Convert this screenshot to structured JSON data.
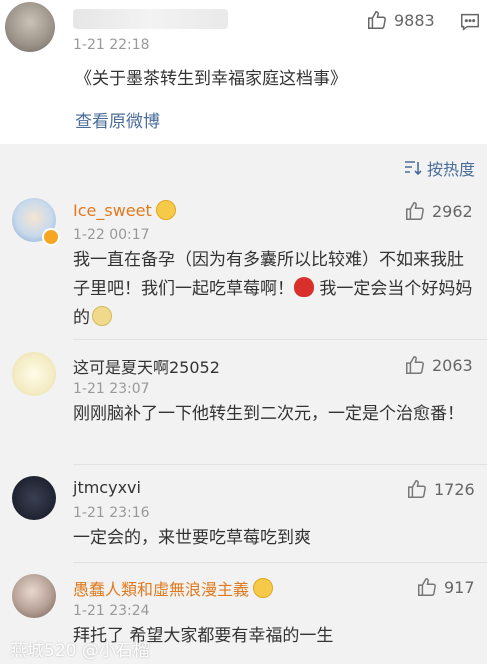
{
  "post": {
    "time": "1-21 22:18",
    "text": "《关于墨茶转生到幸福家庭这档事》",
    "link": "查看原微博",
    "likes": "9883"
  },
  "sort": {
    "label": "按热度"
  },
  "comments": [
    {
      "name": "Ice_sweet",
      "time": "1-22 00:17",
      "likes": "2962",
      "text_1": "我一直在备孕（因为有多囊所以比较难）不如来我肚子里吧！我们一起吃草莓啊！",
      "text_2": " 我一定会当个好妈妈的"
    },
    {
      "name": "这可是夏天啊25052",
      "time": "1-21 23:07",
      "likes": "2063",
      "text": "刚刚脑补了一下他转生到二次元，一定是个治愈番！"
    },
    {
      "name": "jtmcyxvi",
      "time": "1-21 23:16",
      "likes": "1726",
      "text": "一定会的，来世要吃草莓吃到爽"
    },
    {
      "name": "愚蠢人類和虛無浪漫主義",
      "time": "1-21 23:24",
      "likes": "917",
      "text": "拜托了 希望大家都要有幸福的一生"
    }
  ],
  "watermark": "燕城520 @小石榴"
}
